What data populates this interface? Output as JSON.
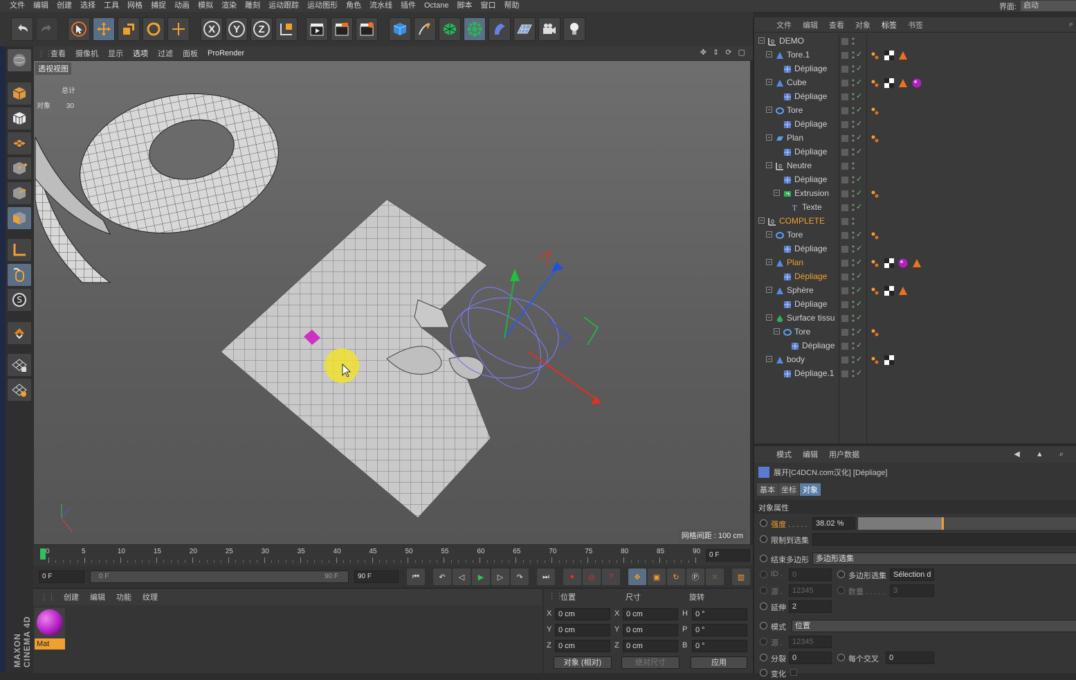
{
  "menubar": {
    "items": [
      "文件",
      "编辑",
      "创建",
      "选择",
      "工具",
      "网格",
      "捕捉",
      "动画",
      "模拟",
      "渲染",
      "雕刻",
      "运动跟踪",
      "运动图形",
      "角色",
      "流水线",
      "插件",
      "Octane",
      "脚本",
      "窗口",
      "帮助"
    ],
    "layout_label": "界面:",
    "layout_value": "启动"
  },
  "toolbar": {
    "axis_x": "X",
    "axis_y": "Y",
    "axis_z": "Z"
  },
  "viewport": {
    "menu": [
      "查看",
      "摄像机",
      "显示",
      "选项",
      "过滤",
      "面板"
    ],
    "prorender": "ProRender",
    "label": "透视视图",
    "stats_total": "总计",
    "stats_objects": "对象",
    "stats_count": "30",
    "grid_distance": "网格间距 : 100 cm"
  },
  "timeline": {
    "ticks": [
      "0",
      "5",
      "10",
      "15",
      "20",
      "25",
      "30",
      "35",
      "40",
      "45",
      "50",
      "55",
      "60",
      "65",
      "70",
      "75",
      "80",
      "85",
      "90"
    ],
    "current_frame": "0 F",
    "start_frame": "0 F",
    "range_start": "0 F",
    "range_end": "90 F",
    "end_frame": "90 F"
  },
  "materials": {
    "menu": [
      "创建",
      "编辑",
      "功能",
      "纹理"
    ],
    "items": [
      {
        "name": "Mat",
        "color": "#b020c0"
      }
    ]
  },
  "coords": {
    "headers": {
      "position": "位置",
      "size": "尺寸",
      "rotation": "旋转"
    },
    "rows": [
      {
        "axis": "X",
        "pos": "0 cm",
        "size_axis": "X",
        "size": "0 cm",
        "rot_axis": "H",
        "rot": "0 °"
      },
      {
        "axis": "Y",
        "pos": "0 cm",
        "size_axis": "Y",
        "size": "0 cm",
        "rot_axis": "P",
        "rot": "0 °"
      },
      {
        "axis": "Z",
        "pos": "0 cm",
        "size_axis": "Z",
        "size": "0 cm",
        "rot_axis": "B",
        "rot": "0 °"
      }
    ],
    "mode_dropdown": "对象 (相对)",
    "size_dropdown": "绝对尺寸",
    "apply_button": "应用"
  },
  "object_manager": {
    "menu": [
      "文件",
      "编辑",
      "查看",
      "对象",
      "标签",
      "书签"
    ],
    "selected_menu": "标签",
    "rows": [
      {
        "name": "DEMO",
        "indent": 0,
        "icon": "null-icon",
        "orange": false,
        "tags": []
      },
      {
        "name": "Tore.1",
        "indent": 1,
        "icon": "polygon-icon",
        "orange": false,
        "tags": [
          "phong-tag-icon",
          "checker-tag-icon",
          "triangle-tag-icon"
        ]
      },
      {
        "name": "Dépliage",
        "indent": 2,
        "icon": "unfold-icon",
        "orange": false,
        "tags": []
      },
      {
        "name": "Cube",
        "indent": 1,
        "icon": "polygon-icon",
        "orange": false,
        "tags": [
          "phong-tag-icon",
          "checker-tag-icon",
          "triangle-tag-icon",
          "material-tag-icon"
        ]
      },
      {
        "name": "Dépliage",
        "indent": 2,
        "icon": "unfold-icon",
        "orange": false,
        "tags": []
      },
      {
        "name": "Tore",
        "indent": 1,
        "icon": "torus-icon",
        "orange": false,
        "tags": [
          "phong-tag-icon"
        ]
      },
      {
        "name": "Dépliage",
        "indent": 2,
        "icon": "unfold-icon",
        "orange": false,
        "tags": []
      },
      {
        "name": "Plan",
        "indent": 1,
        "icon": "plane-icon",
        "orange": false,
        "tags": [
          "phong-tag-icon"
        ]
      },
      {
        "name": "Dépliage",
        "indent": 2,
        "icon": "unfold-icon",
        "orange": false,
        "tags": []
      },
      {
        "name": "Neutre",
        "indent": 1,
        "icon": "null-icon",
        "orange": false,
        "tags": []
      },
      {
        "name": "Dépliage",
        "indent": 2,
        "icon": "unfold-icon",
        "orange": false,
        "tags": []
      },
      {
        "name": "Extrusion",
        "indent": 2,
        "icon": "extrude-icon",
        "orange": false,
        "tags": [
          "phong-tag-icon"
        ]
      },
      {
        "name": "Texte",
        "indent": 3,
        "icon": "text-icon",
        "orange": false,
        "tags": []
      },
      {
        "name": "COMPLETE",
        "indent": 0,
        "icon": "null-icon",
        "orange": true,
        "tags": []
      },
      {
        "name": "Tore",
        "indent": 1,
        "icon": "torus-icon",
        "orange": false,
        "tags": [
          "phong-tag-icon"
        ]
      },
      {
        "name": "Dépliage",
        "indent": 2,
        "icon": "unfold-icon",
        "orange": false,
        "tags": []
      },
      {
        "name": "Plan",
        "indent": 1,
        "icon": "polygon-icon",
        "orange": true,
        "tags": [
          "phong-tag-icon",
          "checker-tag-icon",
          "material-tag-icon",
          "triangle-tag-icon"
        ]
      },
      {
        "name": "Dépliage",
        "indent": 2,
        "icon": "unfold-icon",
        "orange": true,
        "tags": []
      },
      {
        "name": "Sphère",
        "indent": 1,
        "icon": "polygon-icon",
        "orange": false,
        "tags": [
          "phong-tag-icon",
          "checker-tag-icon",
          "triangle-tag-icon"
        ]
      },
      {
        "name": "Dépliage",
        "indent": 2,
        "icon": "unfold-icon",
        "orange": false,
        "tags": []
      },
      {
        "name": "Surface tissu",
        "indent": 1,
        "icon": "cloth-icon",
        "orange": false,
        "tags": []
      },
      {
        "name": "Tore",
        "indent": 2,
        "icon": "torus-icon",
        "orange": false,
        "tags": [
          "phong-tag-icon"
        ]
      },
      {
        "name": "Dépliage",
        "indent": 3,
        "icon": "unfold-icon",
        "orange": false,
        "tags": []
      },
      {
        "name": "body",
        "indent": 1,
        "icon": "polygon-icon",
        "orange": false,
        "tags": [
          "phong-tag-icon",
          "checker-tag-icon"
        ]
      },
      {
        "name": "Dépliage.1",
        "indent": 2,
        "icon": "unfold-icon",
        "orange": false,
        "tags": []
      }
    ]
  },
  "attribute_manager": {
    "menu": [
      "模式",
      "编辑",
      "用户数据"
    ],
    "title": "展开[C4DCN.com汉化] [Dépliage]",
    "tabs": [
      "基本",
      "坐标",
      "对象"
    ],
    "selected_tab": "对象",
    "section": "对象属性",
    "strength_label": "强度 . . . . .",
    "strength_value": "38.02 %",
    "strength_fraction": 0.3802,
    "limit_label": "限制到选集",
    "end_poly_label": "结束多边形",
    "end_poly_value": "多边形选集",
    "id_label": "ID .",
    "id_value": "0",
    "poly_sel_label": "多边形选集",
    "poly_sel_value": "Sélection d",
    "source_label": "源 .",
    "source_value": "12345",
    "count_label": "数量 . . . . .",
    "count_value": "3",
    "extend_label": "延伸",
    "extend_value": "2",
    "mode_label": "模式",
    "mode_value": "位置",
    "source2_label": "源 .",
    "source2_value": "12345",
    "split_label": "分裂",
    "split_value": "0",
    "each_cross_label": "每个交叉",
    "each_cross_value": "0",
    "change_label": "变化"
  },
  "brand": "MAXON CINEMA 4D"
}
